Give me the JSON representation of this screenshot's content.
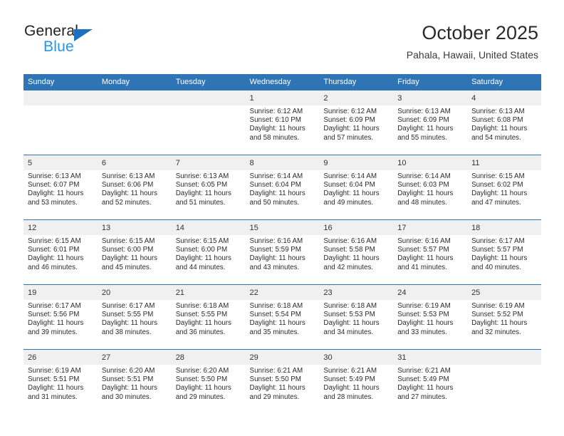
{
  "brand": {
    "name_part1": "General",
    "name_part2": "Blue",
    "accent_color": "#2196f3",
    "triangle_color": "#1f6fc0"
  },
  "header": {
    "title": "October 2025",
    "subtitle": "Pahala, Hawaii, United States",
    "header_bg": "#2f74b5",
    "header_text_color": "#ffffff"
  },
  "calendar": {
    "weekday_headers": [
      "Sunday",
      "Monday",
      "Tuesday",
      "Wednesday",
      "Thursday",
      "Friday",
      "Saturday"
    ],
    "weeks": [
      [
        {
          "day": "",
          "sunrise": "",
          "sunset": "",
          "daylight_line1": "",
          "daylight_line2": ""
        },
        {
          "day": "",
          "sunrise": "",
          "sunset": "",
          "daylight_line1": "",
          "daylight_line2": ""
        },
        {
          "day": "",
          "sunrise": "",
          "sunset": "",
          "daylight_line1": "",
          "daylight_line2": ""
        },
        {
          "day": "1",
          "sunrise": "Sunrise: 6:12 AM",
          "sunset": "Sunset: 6:10 PM",
          "daylight_line1": "Daylight: 11 hours",
          "daylight_line2": "and 58 minutes."
        },
        {
          "day": "2",
          "sunrise": "Sunrise: 6:12 AM",
          "sunset": "Sunset: 6:09 PM",
          "daylight_line1": "Daylight: 11 hours",
          "daylight_line2": "and 57 minutes."
        },
        {
          "day": "3",
          "sunrise": "Sunrise: 6:13 AM",
          "sunset": "Sunset: 6:09 PM",
          "daylight_line1": "Daylight: 11 hours",
          "daylight_line2": "and 55 minutes."
        },
        {
          "day": "4",
          "sunrise": "Sunrise: 6:13 AM",
          "sunset": "Sunset: 6:08 PM",
          "daylight_line1": "Daylight: 11 hours",
          "daylight_line2": "and 54 minutes."
        }
      ],
      [
        {
          "day": "5",
          "sunrise": "Sunrise: 6:13 AM",
          "sunset": "Sunset: 6:07 PM",
          "daylight_line1": "Daylight: 11 hours",
          "daylight_line2": "and 53 minutes."
        },
        {
          "day": "6",
          "sunrise": "Sunrise: 6:13 AM",
          "sunset": "Sunset: 6:06 PM",
          "daylight_line1": "Daylight: 11 hours",
          "daylight_line2": "and 52 minutes."
        },
        {
          "day": "7",
          "sunrise": "Sunrise: 6:13 AM",
          "sunset": "Sunset: 6:05 PM",
          "daylight_line1": "Daylight: 11 hours",
          "daylight_line2": "and 51 minutes."
        },
        {
          "day": "8",
          "sunrise": "Sunrise: 6:14 AM",
          "sunset": "Sunset: 6:04 PM",
          "daylight_line1": "Daylight: 11 hours",
          "daylight_line2": "and 50 minutes."
        },
        {
          "day": "9",
          "sunrise": "Sunrise: 6:14 AM",
          "sunset": "Sunset: 6:04 PM",
          "daylight_line1": "Daylight: 11 hours",
          "daylight_line2": "and 49 minutes."
        },
        {
          "day": "10",
          "sunrise": "Sunrise: 6:14 AM",
          "sunset": "Sunset: 6:03 PM",
          "daylight_line1": "Daylight: 11 hours",
          "daylight_line2": "and 48 minutes."
        },
        {
          "day": "11",
          "sunrise": "Sunrise: 6:15 AM",
          "sunset": "Sunset: 6:02 PM",
          "daylight_line1": "Daylight: 11 hours",
          "daylight_line2": "and 47 minutes."
        }
      ],
      [
        {
          "day": "12",
          "sunrise": "Sunrise: 6:15 AM",
          "sunset": "Sunset: 6:01 PM",
          "daylight_line1": "Daylight: 11 hours",
          "daylight_line2": "and 46 minutes."
        },
        {
          "day": "13",
          "sunrise": "Sunrise: 6:15 AM",
          "sunset": "Sunset: 6:00 PM",
          "daylight_line1": "Daylight: 11 hours",
          "daylight_line2": "and 45 minutes."
        },
        {
          "day": "14",
          "sunrise": "Sunrise: 6:15 AM",
          "sunset": "Sunset: 6:00 PM",
          "daylight_line1": "Daylight: 11 hours",
          "daylight_line2": "and 44 minutes."
        },
        {
          "day": "15",
          "sunrise": "Sunrise: 6:16 AM",
          "sunset": "Sunset: 5:59 PM",
          "daylight_line1": "Daylight: 11 hours",
          "daylight_line2": "and 43 minutes."
        },
        {
          "day": "16",
          "sunrise": "Sunrise: 6:16 AM",
          "sunset": "Sunset: 5:58 PM",
          "daylight_line1": "Daylight: 11 hours",
          "daylight_line2": "and 42 minutes."
        },
        {
          "day": "17",
          "sunrise": "Sunrise: 6:16 AM",
          "sunset": "Sunset: 5:57 PM",
          "daylight_line1": "Daylight: 11 hours",
          "daylight_line2": "and 41 minutes."
        },
        {
          "day": "18",
          "sunrise": "Sunrise: 6:17 AM",
          "sunset": "Sunset: 5:57 PM",
          "daylight_line1": "Daylight: 11 hours",
          "daylight_line2": "and 40 minutes."
        }
      ],
      [
        {
          "day": "19",
          "sunrise": "Sunrise: 6:17 AM",
          "sunset": "Sunset: 5:56 PM",
          "daylight_line1": "Daylight: 11 hours",
          "daylight_line2": "and 39 minutes."
        },
        {
          "day": "20",
          "sunrise": "Sunrise: 6:17 AM",
          "sunset": "Sunset: 5:55 PM",
          "daylight_line1": "Daylight: 11 hours",
          "daylight_line2": "and 38 minutes."
        },
        {
          "day": "21",
          "sunrise": "Sunrise: 6:18 AM",
          "sunset": "Sunset: 5:55 PM",
          "daylight_line1": "Daylight: 11 hours",
          "daylight_line2": "and 36 minutes."
        },
        {
          "day": "22",
          "sunrise": "Sunrise: 6:18 AM",
          "sunset": "Sunset: 5:54 PM",
          "daylight_line1": "Daylight: 11 hours",
          "daylight_line2": "and 35 minutes."
        },
        {
          "day": "23",
          "sunrise": "Sunrise: 6:18 AM",
          "sunset": "Sunset: 5:53 PM",
          "daylight_line1": "Daylight: 11 hours",
          "daylight_line2": "and 34 minutes."
        },
        {
          "day": "24",
          "sunrise": "Sunrise: 6:19 AM",
          "sunset": "Sunset: 5:53 PM",
          "daylight_line1": "Daylight: 11 hours",
          "daylight_line2": "and 33 minutes."
        },
        {
          "day": "25",
          "sunrise": "Sunrise: 6:19 AM",
          "sunset": "Sunset: 5:52 PM",
          "daylight_line1": "Daylight: 11 hours",
          "daylight_line2": "and 32 minutes."
        }
      ],
      [
        {
          "day": "26",
          "sunrise": "Sunrise: 6:19 AM",
          "sunset": "Sunset: 5:51 PM",
          "daylight_line1": "Daylight: 11 hours",
          "daylight_line2": "and 31 minutes."
        },
        {
          "day": "27",
          "sunrise": "Sunrise: 6:20 AM",
          "sunset": "Sunset: 5:51 PM",
          "daylight_line1": "Daylight: 11 hours",
          "daylight_line2": "and 30 minutes."
        },
        {
          "day": "28",
          "sunrise": "Sunrise: 6:20 AM",
          "sunset": "Sunset: 5:50 PM",
          "daylight_line1": "Daylight: 11 hours",
          "daylight_line2": "and 29 minutes."
        },
        {
          "day": "29",
          "sunrise": "Sunrise: 6:21 AM",
          "sunset": "Sunset: 5:50 PM",
          "daylight_line1": "Daylight: 11 hours",
          "daylight_line2": "and 29 minutes."
        },
        {
          "day": "30",
          "sunrise": "Sunrise: 6:21 AM",
          "sunset": "Sunset: 5:49 PM",
          "daylight_line1": "Daylight: 11 hours",
          "daylight_line2": "and 28 minutes."
        },
        {
          "day": "31",
          "sunrise": "Sunrise: 6:21 AM",
          "sunset": "Sunset: 5:49 PM",
          "daylight_line1": "Daylight: 11 hours",
          "daylight_line2": "and 27 minutes."
        },
        {
          "day": "",
          "sunrise": "",
          "sunset": "",
          "daylight_line1": "",
          "daylight_line2": ""
        }
      ]
    ]
  }
}
